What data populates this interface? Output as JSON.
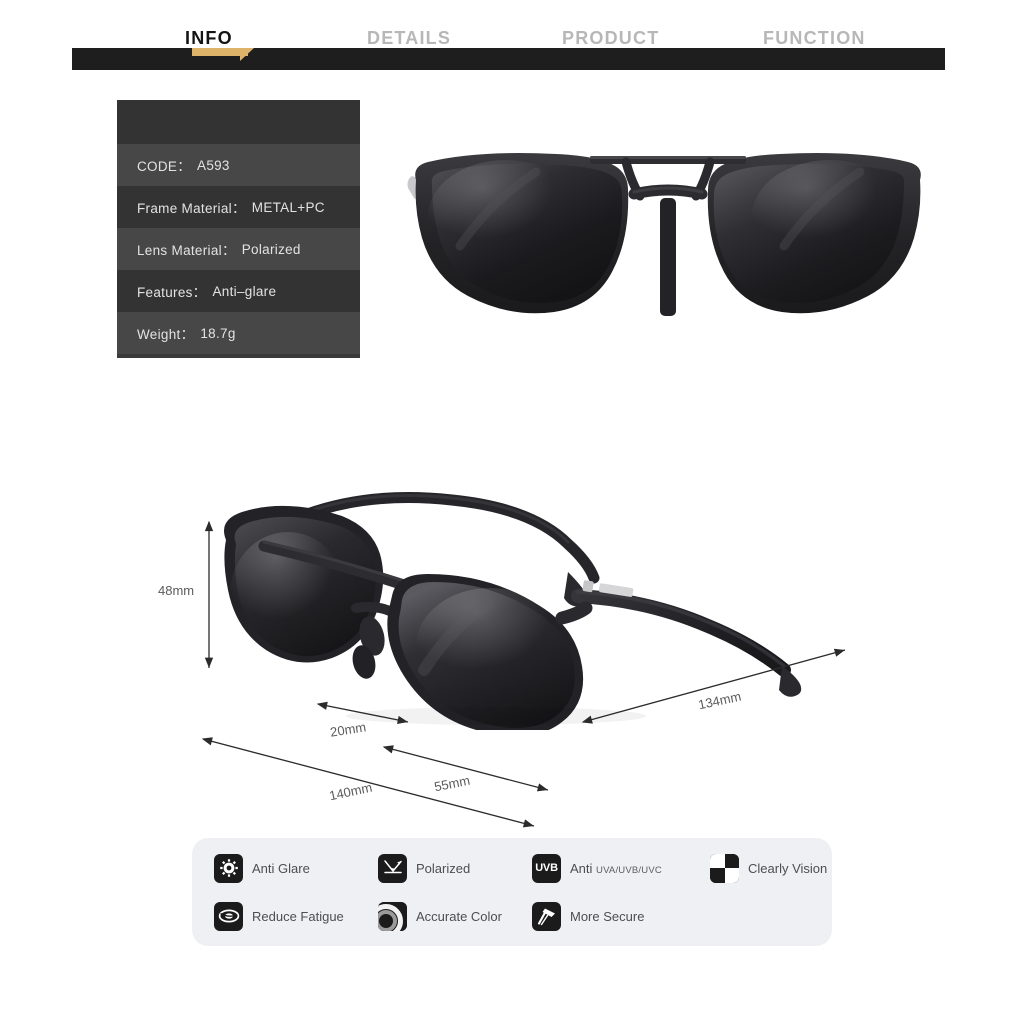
{
  "tabs": [
    {
      "label": "INFO",
      "active": true
    },
    {
      "label": "DETAILS",
      "active": false
    },
    {
      "label": "PRODUCT",
      "active": false
    },
    {
      "label": "FUNCTION",
      "active": false
    }
  ],
  "spec_table": {
    "rows": [
      {
        "label": "CODE：",
        "value": "A593"
      },
      {
        "label": "Frame Material：",
        "value": "METAL+PC"
      },
      {
        "label": "Lens Material：",
        "value": "Polarized"
      },
      {
        "label": "Features：",
        "value": "Anti–glare"
      },
      {
        "label": "Weight：",
        "value": "18.7g"
      }
    ]
  },
  "dimensions": {
    "lens_height": "48mm",
    "bridge": "20mm",
    "lens_width": "55mm",
    "frame_width": "140mm",
    "temple_length": "134mm"
  },
  "features": {
    "row1": [
      {
        "icon": "anti-glare-sun-icon",
        "label": "Anti Glare",
        "small": ""
      },
      {
        "icon": "polarized-rays-icon",
        "label": "Polarized",
        "small": ""
      },
      {
        "icon": "uvb-badge-icon",
        "label": "Anti",
        "small": "UVA/UVB/UVC",
        "icon_text": "UVB"
      },
      {
        "icon": "checkerboard-icon",
        "label": "Clearly Vision",
        "small": ""
      }
    ],
    "row2": [
      {
        "icon": "eye-icon",
        "label": "Reduce Fatigue",
        "small": ""
      },
      {
        "icon": "color-wheel-icon",
        "label": "Accurate Color",
        "small": ""
      },
      {
        "icon": "hammer-icon",
        "label": "More Secure",
        "small": ""
      }
    ]
  },
  "colors": {
    "accent_gold": "#dcb368",
    "strip_black": "#1e1e1e",
    "spec_dark": "#333333",
    "spec_light": "#474747",
    "panel_bg": "#eef0f3",
    "frame_black": "#232326"
  },
  "product": {
    "front_view_alt": "black-sunglasses-front-view",
    "angle_view_alt": "black-sunglasses-angle-view"
  }
}
